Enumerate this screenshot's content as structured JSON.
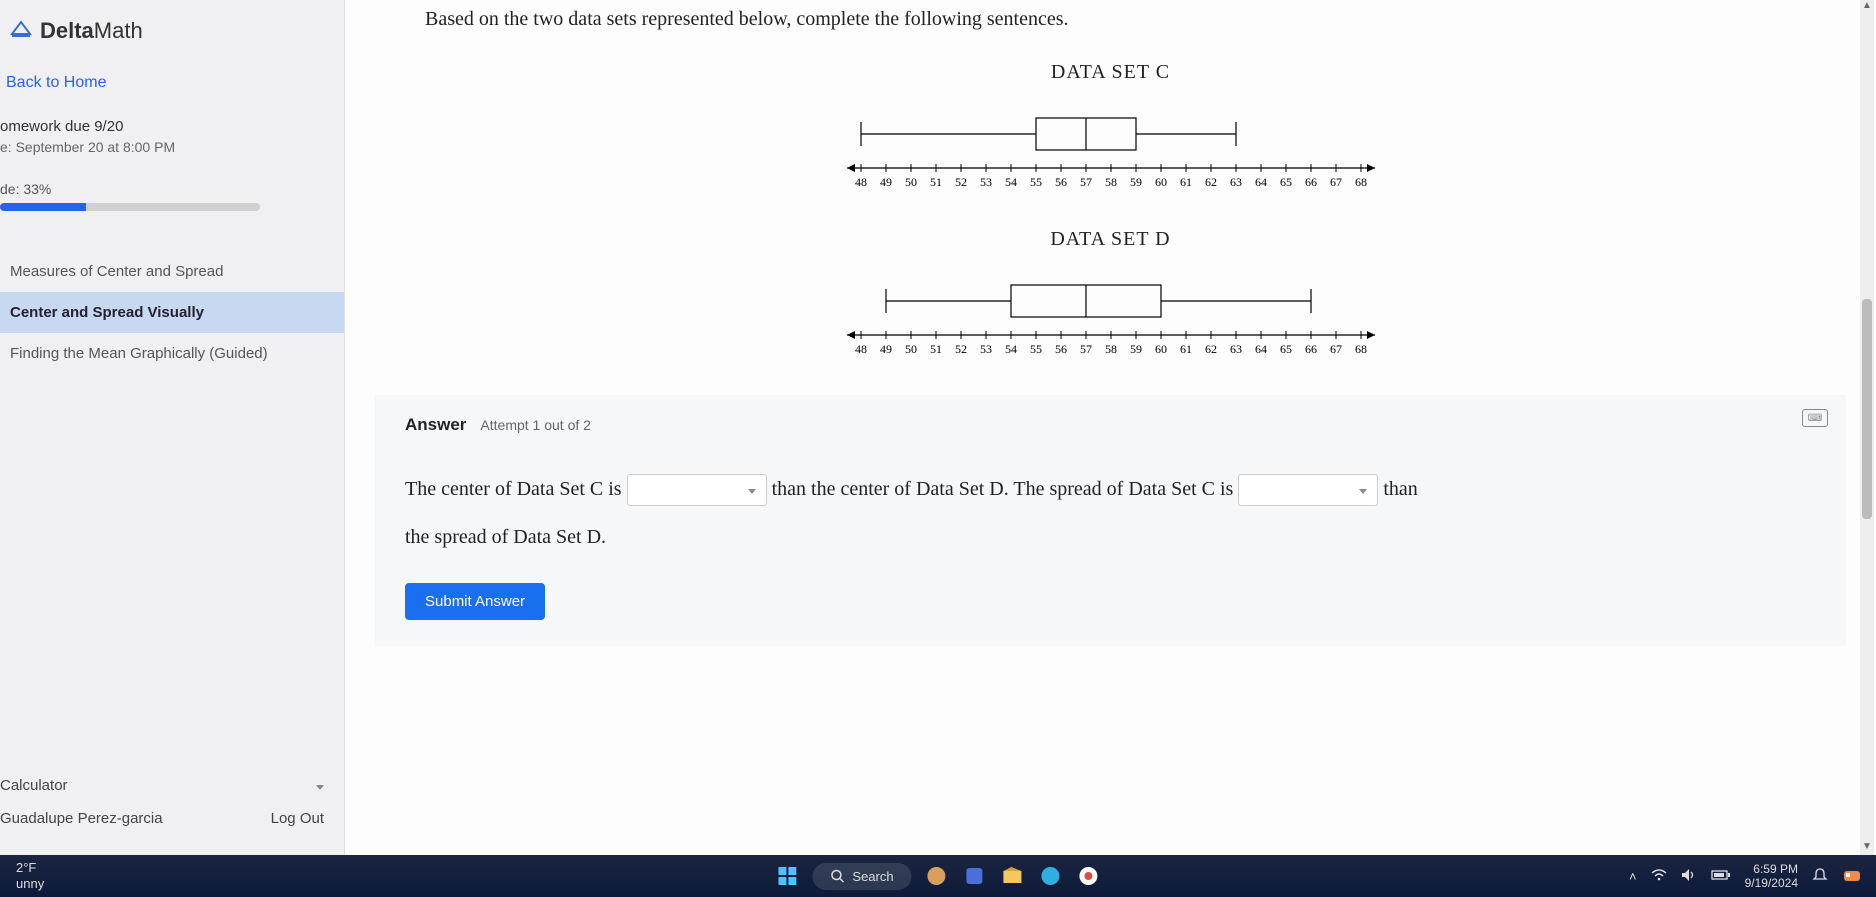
{
  "brand": {
    "bold": "Delta",
    "light": "Math"
  },
  "sidebar": {
    "back": "Back to Home",
    "assignment_title": "omework due 9/20",
    "assignment_due": "e: September 20 at 8:00 PM",
    "grade_label": "de: 33%",
    "grade_pct": 33,
    "topics": [
      {
        "label": "Measures of Center and Spread",
        "active": false
      },
      {
        "label": "Center and Spread Visually",
        "active": true
      },
      {
        "label": "Finding the Mean Graphically (Guided)",
        "active": false
      }
    ],
    "calculator": "Calculator",
    "user": "Guadalupe Perez-garcia",
    "logout": "Log Out"
  },
  "prompt": "Based on the two data sets represented below, complete the following sentences.",
  "chart_data": [
    {
      "type": "boxplot",
      "title": "DATA SET C",
      "axis_min": 48,
      "axis_max": 68,
      "ticks": [
        48,
        49,
        50,
        51,
        52,
        53,
        54,
        55,
        56,
        57,
        58,
        59,
        60,
        61,
        62,
        63,
        64,
        65,
        66,
        67,
        68
      ],
      "min": 48,
      "q1": 55,
      "median": 57,
      "q3": 59,
      "max": 63
    },
    {
      "type": "boxplot",
      "title": "DATA SET D",
      "axis_min": 48,
      "axis_max": 68,
      "ticks": [
        48,
        49,
        50,
        51,
        52,
        53,
        54,
        55,
        56,
        57,
        58,
        59,
        60,
        61,
        62,
        63,
        64,
        65,
        66,
        67,
        68
      ],
      "min": 49,
      "q1": 54,
      "median": 57,
      "q3": 60,
      "max": 66
    }
  ],
  "answer": {
    "label": "Answer",
    "attempt": "Attempt 1 out of 2",
    "text_part1": "The center of Data Set C is",
    "text_part2": "than the center of Data Set D. The spread of Data Set C is",
    "text_part3": "than",
    "text_part4": "the spread of Data Set D.",
    "submit": "Submit Answer"
  },
  "taskbar": {
    "temp": "2°F",
    "cond": "unny",
    "search": "Search",
    "time": "6:59 PM",
    "date": "9/19/2024"
  }
}
